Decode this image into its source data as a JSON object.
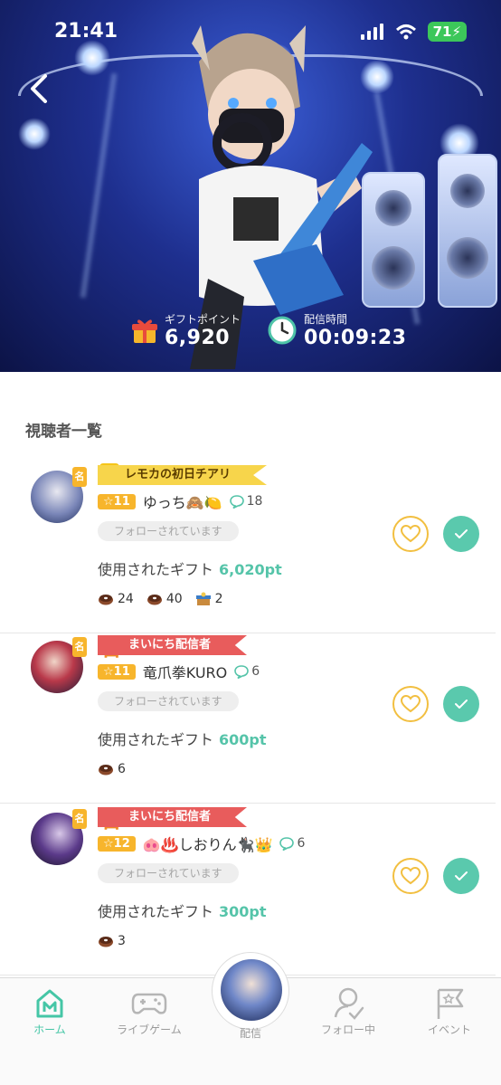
{
  "status_bar": {
    "time": "21:41",
    "battery": "71"
  },
  "hero": {
    "gift_points_label": "ギフトポイント",
    "gift_points_value": "6,920",
    "stream_time_label": "配信時間",
    "stream_time_value": "00:09:23"
  },
  "section_title": "視聴者一覧",
  "viewers": [
    {
      "rank_badge": "名",
      "banner": "レモカの初日チアリ",
      "banner_style": "yellow",
      "level": "11",
      "name": "ゆっち🙈🍋",
      "comments": "18",
      "follow_status": "フォローされています",
      "gift_label": "使用されたギフト",
      "gift_points": "6,020pt",
      "items": [
        {
          "icon": "donut-icon",
          "count": "24"
        },
        {
          "icon": "donut-icon",
          "count": "40"
        },
        {
          "icon": "gift-box-icon",
          "count": "2"
        }
      ]
    },
    {
      "rank_badge": "名",
      "banner": "まいにち配信者",
      "banner_style": "red",
      "level": "11",
      "name": "竜爪拳KURO",
      "comments": "6",
      "follow_status": "フォローされています",
      "gift_label": "使用されたギフト",
      "gift_points": "600pt",
      "items": [
        {
          "icon": "donut-icon",
          "count": "6"
        }
      ]
    },
    {
      "rank_badge": "名",
      "banner": "まいにち配信者",
      "banner_style": "red",
      "level": "12",
      "name": "🐽♨️しおりん🐈‍⬛👑",
      "comments": "6",
      "follow_status": "フォローされています",
      "gift_label": "使用されたギフト",
      "gift_points": "300pt",
      "items": [
        {
          "icon": "donut-icon",
          "count": "3"
        }
      ]
    }
  ],
  "tabbar": {
    "home": "ホーム",
    "live_game": "ライブゲーム",
    "broadcast": "配信",
    "following": "フォロー中",
    "event": "イベント"
  },
  "colors": {
    "accent": "#55c4a9",
    "level": "#f7b52c",
    "heart": "#f2bf40",
    "banner_red": "#e85c5c",
    "banner_yellow": "#f7d54b"
  }
}
